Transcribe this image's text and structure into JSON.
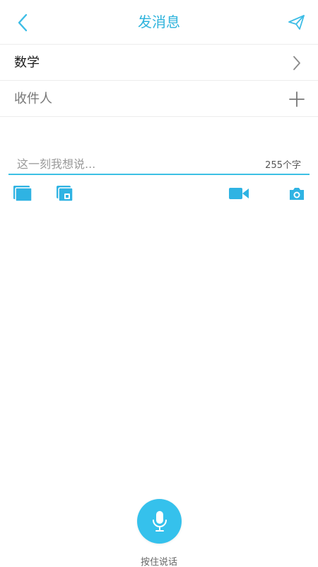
{
  "header": {
    "title": "发消息",
    "back_icon": "chevron-left-icon",
    "send_icon": "paper-plane-icon"
  },
  "subject_row": {
    "label": "数学",
    "icon": "chevron-right-icon"
  },
  "recipient_row": {
    "label": "收件人",
    "icon": "plus-icon"
  },
  "compose": {
    "placeholder": "这一刻我想说...",
    "counter": "255个字"
  },
  "toolbar": {
    "items": [
      "gallery-icon",
      "file-icon",
      "video-camera-icon",
      "camera-icon"
    ]
  },
  "voice": {
    "label": "按住说话",
    "icon": "microphone-icon"
  },
  "colors": {
    "accent": "#2eb3dc",
    "mic_bg": "#35c1ec",
    "divider": "#ececec"
  }
}
